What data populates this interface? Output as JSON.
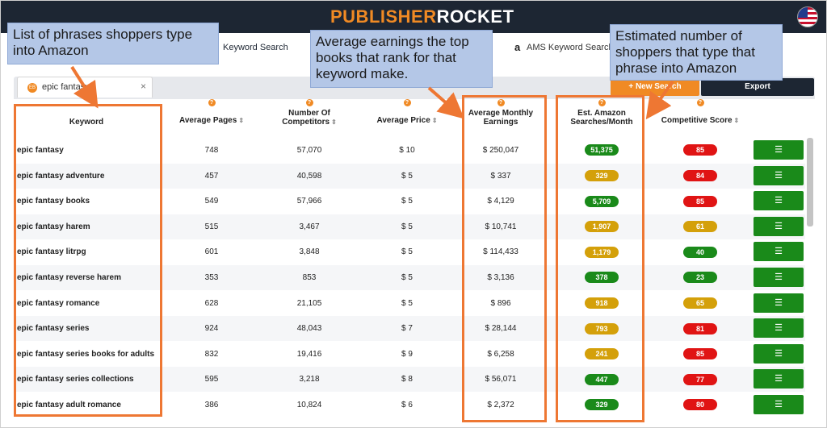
{
  "app": {
    "logo_part1": "PUBLISHER",
    "logo_part2": "ROCKET"
  },
  "nav": {
    "keyword_search": "Keyword Search",
    "ams_keyword_search": "AMS Keyword Search",
    "ams_icon": "a"
  },
  "tab": {
    "badge": "EB",
    "label": "epic fantasy",
    "close": "×"
  },
  "toolbar": {
    "new_search": "+ New Search",
    "export": "Export"
  },
  "headers": {
    "keyword": "Keyword",
    "avg_pages": "Average Pages",
    "competitors_l1": "Number Of",
    "competitors_l2": "Competitors",
    "avg_price": "Average Price",
    "earnings_l1": "Average Monthly",
    "earnings_l2": "Earnings",
    "searches_l1": "Est. Amazon",
    "searches_l2": "Searches/Month",
    "score": "Competitive Score",
    "help": "?",
    "sort": "⇕"
  },
  "rows": [
    {
      "keyword": "epic fantasy",
      "pages": "748",
      "competitors": "57,070",
      "price": "$ 10",
      "earnings": "$ 250,047",
      "searches": "51,375",
      "searches_color": "green",
      "score": "85",
      "score_color": "red"
    },
    {
      "keyword": "epic fantasy adventure",
      "pages": "457",
      "competitors": "40,598",
      "price": "$ 5",
      "earnings": "$ 337",
      "searches": "329",
      "searches_color": "yellow",
      "score": "84",
      "score_color": "red"
    },
    {
      "keyword": "epic fantasy books",
      "pages": "549",
      "competitors": "57,966",
      "price": "$ 5",
      "earnings": "$ 4,129",
      "searches": "5,709",
      "searches_color": "green",
      "score": "85",
      "score_color": "red"
    },
    {
      "keyword": "epic fantasy harem",
      "pages": "515",
      "competitors": "3,467",
      "price": "$ 5",
      "earnings": "$ 10,741",
      "searches": "1,907",
      "searches_color": "yellow",
      "score": "61",
      "score_color": "yellow"
    },
    {
      "keyword": "epic fantasy litrpg",
      "pages": "601",
      "competitors": "3,848",
      "price": "$ 5",
      "earnings": "$ 114,433",
      "searches": "1,179",
      "searches_color": "yellow",
      "score": "40",
      "score_color": "green"
    },
    {
      "keyword": "epic fantasy reverse harem",
      "pages": "353",
      "competitors": "853",
      "price": "$ 5",
      "earnings": "$ 3,136",
      "searches": "378",
      "searches_color": "green",
      "score": "23",
      "score_color": "green"
    },
    {
      "keyword": "epic fantasy romance",
      "pages": "628",
      "competitors": "21,105",
      "price": "$ 5",
      "earnings": "$ 896",
      "searches": "918",
      "searches_color": "yellow",
      "score": "65",
      "score_color": "yellow"
    },
    {
      "keyword": "epic fantasy series",
      "pages": "924",
      "competitors": "48,043",
      "price": "$ 7",
      "earnings": "$ 28,144",
      "searches": "793",
      "searches_color": "yellow",
      "score": "81",
      "score_color": "red"
    },
    {
      "keyword": "epic fantasy series books for adults",
      "pages": "832",
      "competitors": "19,416",
      "price": "$ 9",
      "earnings": "$ 6,258",
      "searches": "241",
      "searches_color": "yellow",
      "score": "85",
      "score_color": "red"
    },
    {
      "keyword": "epic fantasy series collections",
      "pages": "595",
      "competitors": "3,218",
      "price": "$ 8",
      "earnings": "$ 56,071",
      "searches": "447",
      "searches_color": "green",
      "score": "77",
      "score_color": "red"
    },
    {
      "keyword": "epic fantasy adult romance",
      "pages": "386",
      "competitors": "10,824",
      "price": "$ 6",
      "earnings": "$ 2,372",
      "searches": "329",
      "searches_color": "green",
      "score": "80",
      "score_color": "red"
    }
  ],
  "row_action_icon": "list-icon",
  "row_action_glyph": "☰",
  "callouts": {
    "phrases": "List of phrases shoppers type into Amazon",
    "earnings": "Average earnings the top books that rank for that keyword make.",
    "shoppers": "Estimated number of shoppers that type that phrase into Amazon"
  },
  "colors": {
    "accent": "#f08a24",
    "dark": "#1d2633",
    "green": "#1a8a1a",
    "yellow": "#d4a00a",
    "red": "#e01414",
    "callout": "#b4c7e7",
    "highlight": "#ee7733"
  }
}
